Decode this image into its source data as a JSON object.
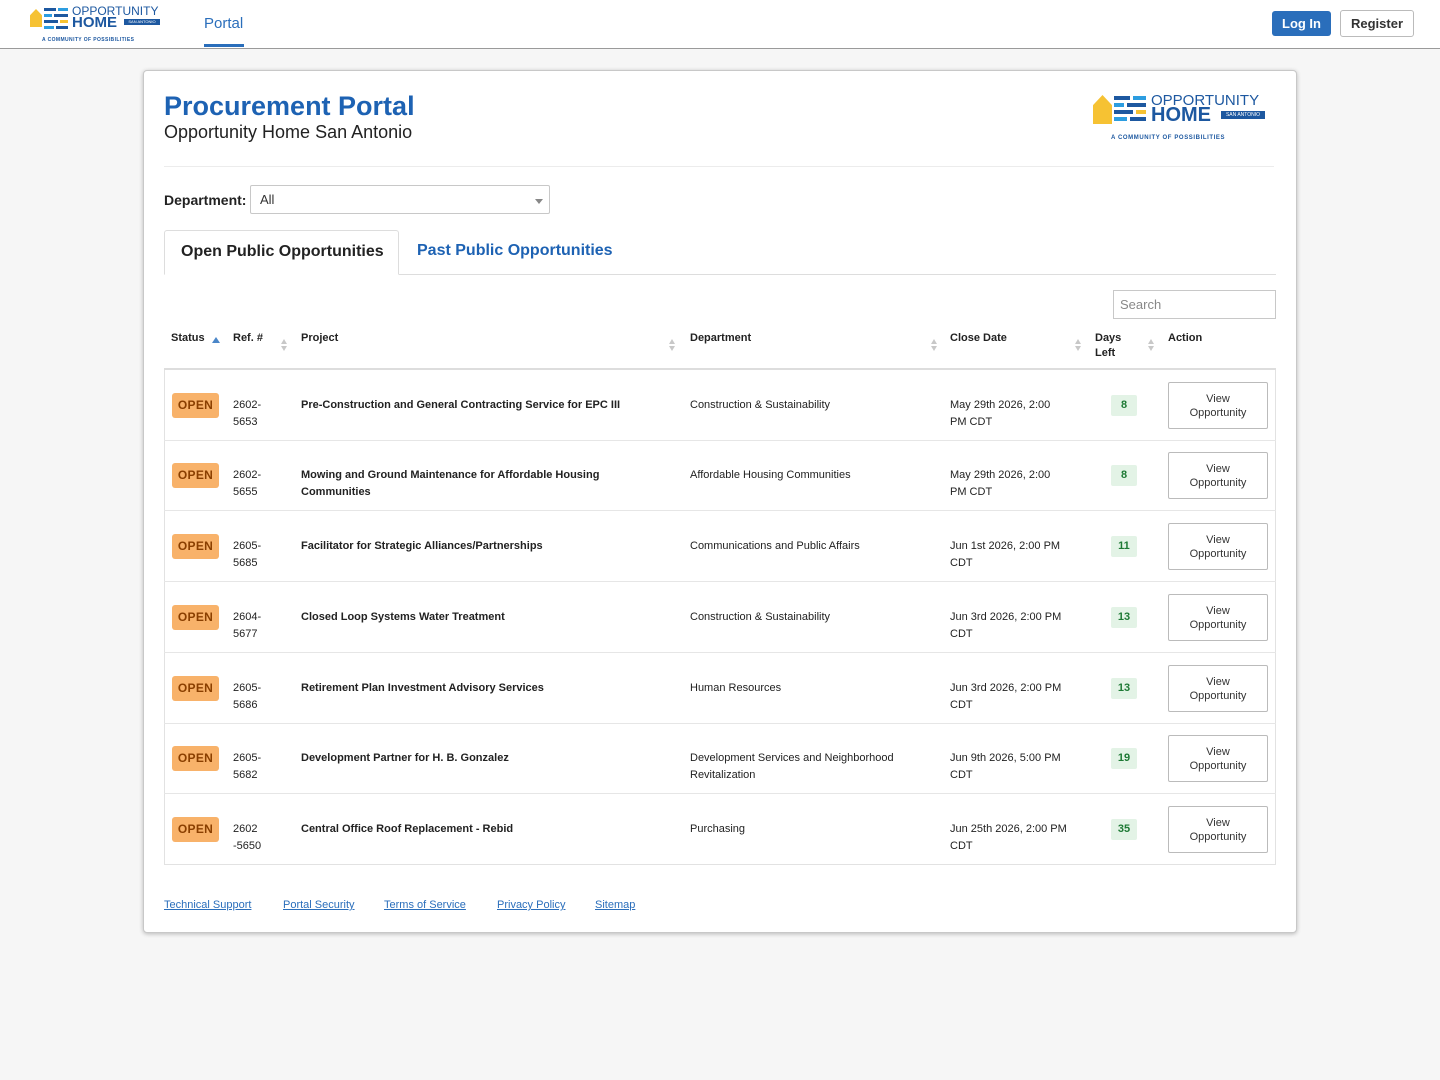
{
  "header": {
    "logo_text_top": "OPPORTUNITY",
    "logo_text_home": "HOME",
    "logo_tag": "SAN ANTONIO",
    "logo_tagline": "A COMMUNITY OF POSSIBILITIES",
    "nav_portal": "Portal",
    "login_label": "Log In",
    "register_label": "Register"
  },
  "page": {
    "title": "Procurement Portal",
    "subtitle": "Opportunity Home San Antonio"
  },
  "filter": {
    "department_label": "Department:",
    "department_value": "All"
  },
  "tabs": {
    "open_label": "Open Public Opportunities",
    "past_label": "Past Public Opportunities"
  },
  "search": {
    "placeholder": "Search"
  },
  "table": {
    "columns": {
      "status": "Status",
      "ref": "Ref. #",
      "project": "Project",
      "department": "Department",
      "close_date": "Close Date",
      "days_left_1": "Days",
      "days_left_2": "Left",
      "action": "Action"
    },
    "view_label_1": "View",
    "view_label_2": "Opportunity",
    "rows": [
      {
        "status": "OPEN",
        "ref_1": "2602-",
        "ref_2": "5653",
        "project_1": "Pre-Construction and General Contracting Service for EPC III",
        "project_2": "",
        "department_1": "Construction & Sustainability",
        "department_2": "",
        "close_1": "May 29th 2026, 2:00",
        "close_2": "PM CDT",
        "days": "8"
      },
      {
        "status": "OPEN",
        "ref_1": "2602-",
        "ref_2": "5655",
        "project_1": "Mowing and Ground Maintenance for Affordable Housing",
        "project_2": "Communities",
        "department_1": "Affordable Housing Communities",
        "department_2": "",
        "close_1": "May 29th 2026, 2:00",
        "close_2": "PM CDT",
        "days": "8"
      },
      {
        "status": "OPEN",
        "ref_1": "2605-",
        "ref_2": "5685",
        "project_1": "Facilitator for Strategic Alliances/Partnerships",
        "project_2": "",
        "department_1": "Communications and Public Affairs",
        "department_2": "",
        "close_1": "Jun 1st 2026, 2:00 PM",
        "close_2": "CDT",
        "days": "11"
      },
      {
        "status": "OPEN",
        "ref_1": "2604-",
        "ref_2": "5677",
        "project_1": "Closed Loop Systems Water Treatment",
        "project_2": "",
        "department_1": "Construction & Sustainability",
        "department_2": "",
        "close_1": "Jun 3rd 2026, 2:00 PM",
        "close_2": "CDT",
        "days": "13"
      },
      {
        "status": "OPEN",
        "ref_1": "2605-",
        "ref_2": "5686",
        "project_1": "Retirement Plan Investment Advisory Services",
        "project_2": "",
        "department_1": "Human Resources",
        "department_2": "",
        "close_1": "Jun 3rd 2026, 2:00 PM",
        "close_2": "CDT",
        "days": "13"
      },
      {
        "status": "OPEN",
        "ref_1": "2605-",
        "ref_2": "5682",
        "project_1": "Development Partner for H. B. Gonzalez",
        "project_2": "",
        "department_1": "Development Services and Neighborhood",
        "department_2": "Revitalization",
        "close_1": "Jun 9th 2026, 5:00 PM",
        "close_2": "CDT",
        "days": "19"
      },
      {
        "status": "OPEN",
        "ref_1": "2602",
        "ref_2": "-5650",
        "project_1": "Central Office Roof Replacement - Rebid",
        "project_2": "",
        "department_1": "Purchasing",
        "department_2": "",
        "close_1": "Jun 25th 2026, 2:00 PM",
        "close_2": "CDT",
        "days": "35"
      }
    ]
  },
  "footer": {
    "links": [
      "Technical Support",
      "Portal Security",
      "Terms of Service",
      "Privacy Policy",
      "Sitemap"
    ]
  },
  "colors": {
    "brand_blue": "#1d62b3",
    "link_blue": "#2a6ebb",
    "open_badge": "#f8b26a",
    "days_badge": "#e3f3e6",
    "logo_yellow": "#f6c233"
  }
}
